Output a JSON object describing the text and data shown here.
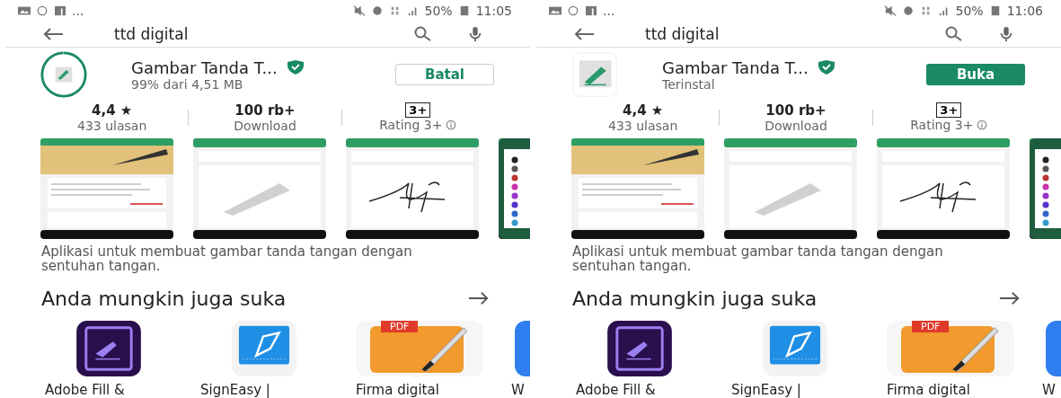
{
  "screens": [
    {
      "status_bar": {
        "notifications": "...",
        "battery": "50%",
        "time": "11:05"
      },
      "search": {
        "query": "ttd digital"
      },
      "app": {
        "name": "Gambar Tanda T...",
        "subtitle": "99% dari 4,51 MB",
        "kind": "downloading",
        "level": 0.99,
        "button": {
          "label": "Batal",
          "kind": "outlined"
        }
      },
      "stats": [
        {
          "kind": "text",
          "value": "4,4 ★",
          "label": "433 ulasan"
        },
        {
          "kind": "text",
          "value": "100 rb+",
          "label": "Download"
        },
        {
          "kind": "badge",
          "value": "3+",
          "label": "Rating 3+"
        }
      ],
      "screenshots": [
        {
          "kind": "intro"
        },
        {
          "kind": "pencil"
        },
        {
          "kind": "signature"
        },
        {
          "kind": "colors"
        }
      ],
      "description": "Aplikasi untuk membuat gambar tanda tangan dengan sentuhan tangan.",
      "section_title": "Anda mungkin juga suka",
      "similar_apps": [
        {
          "kind": "adobe",
          "name": "Adobe Fill &"
        },
        {
          "kind": "signeasy",
          "name": "SignEasy |"
        },
        {
          "kind": "pdf",
          "badge": "PDF",
          "name": "Firma digital"
        },
        {
          "kind": "blue",
          "name": "W"
        }
      ]
    },
    {
      "status_bar": {
        "notifications": "...",
        "battery": "50%",
        "time": "11:06"
      },
      "search": {
        "query": "ttd digital"
      },
      "app": {
        "name": "Gambar Tanda T...",
        "subtitle": "Terinstal",
        "kind": "installed",
        "button": {
          "label": "Buka",
          "kind": "filled"
        }
      },
      "stats": [
        {
          "kind": "text",
          "value": "4,4 ★",
          "label": "433 ulasan"
        },
        {
          "kind": "text",
          "value": "100 rb+",
          "label": "Download"
        },
        {
          "kind": "badge",
          "value": "3+",
          "label": "Rating 3+"
        }
      ],
      "screenshots": [
        {
          "kind": "intro"
        },
        {
          "kind": "pencil"
        },
        {
          "kind": "signature"
        },
        {
          "kind": "colors"
        }
      ],
      "description": "Aplikasi untuk membuat gambar tanda tangan dengan sentuhan tangan.",
      "section_title": "Anda mungkin juga suka",
      "similar_apps": [
        {
          "kind": "adobe",
          "name": "Adobe Fill &"
        },
        {
          "kind": "signeasy",
          "name": "SignEasy |"
        },
        {
          "kind": "pdf",
          "badge": "PDF",
          "name": "Firma digital"
        },
        {
          "kind": "blue",
          "name": "W"
        }
      ]
    }
  ]
}
